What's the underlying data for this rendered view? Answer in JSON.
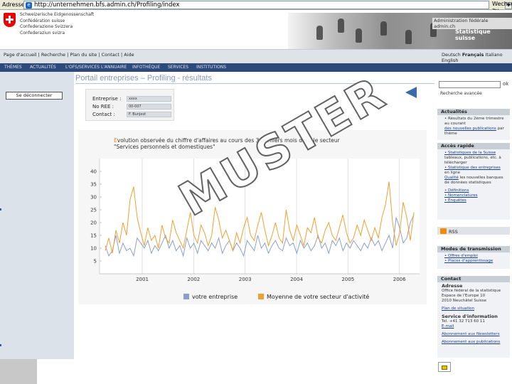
{
  "address_bar": {
    "label": "Adresse",
    "url": "http://unternehmen.bfs.admin.ch/Profiling/index",
    "go": "Wechseln zu"
  },
  "header": {
    "confederation": [
      "Schweizerische Eidgenossenschaft",
      "Confédération suisse",
      "Confederazione Svizzera",
      "Confederaziun svizra"
    ],
    "admin_link": "Administration fédérale admin.ch",
    "office": "Statistique suisse"
  },
  "utility": {
    "links": "Page d'accueil | Recherche | Plan du site | Contact | Aide",
    "lang_prefix": "Deutsch",
    "lang_current": "Français",
    "lang_it": "Italiano",
    "lang_en": "English"
  },
  "nav": [
    "THÈMES",
    "ACTUALITÉS",
    "L'OFS/SERVICES",
    "L'ANNUAIRE",
    "INFOTHÈQUE",
    "SERVICES",
    "INSTITUTIONS"
  ],
  "left": {
    "logout": "Se déconnecter"
  },
  "main": {
    "title": "Portail entreprises – Profiling - résultats",
    "labels": [
      "Entreprise :",
      "No REE :",
      "Contact :"
    ],
    "values": [
      "xxxx",
      "00-007",
      "F. Bunjest"
    ]
  },
  "chart_data": {
    "type": "line",
    "title_first": "E",
    "title_line1": "volution observée du chiffre d'affaires au cours des 3 derniers mois dans le secteur",
    "title_line2": "\"Services personnels et domestiques\"",
    "ylim": [
      0,
      45
    ],
    "yticks": [
      5,
      10,
      15,
      20,
      25,
      30,
      35,
      40
    ],
    "xticks": [
      "2001",
      "2002",
      "2003",
      "2004",
      "2005",
      "2006"
    ],
    "colors": {
      "company": "#8aa0c8",
      "sector": "#f0a030"
    },
    "series": [
      {
        "name": "votre entreprise",
        "values": [
          11,
          7,
          9,
          15,
          8,
          12,
          9,
          10,
          7,
          14,
          12,
          10,
          13,
          8,
          11,
          9,
          12,
          15,
          10,
          13,
          9,
          11,
          7,
          14,
          10,
          12,
          8,
          13,
          11,
          9,
          12,
          10,
          14,
          8,
          11,
          13,
          9,
          12,
          10,
          7,
          13,
          11,
          9,
          15,
          10,
          12,
          8,
          11,
          13,
          10,
          9,
          14,
          11,
          12,
          8,
          13,
          10,
          12,
          9,
          11,
          15,
          10,
          12,
          8,
          13,
          11,
          14,
          9,
          12,
          10,
          13,
          11,
          9,
          12,
          10,
          14,
          11,
          13,
          9,
          12,
          15,
          10,
          22,
          18,
          12,
          14,
          20,
          23
        ]
      },
      {
        "name": "Moyenne de votre secteur d'activité",
        "values": [
          9,
          14,
          8,
          17,
          12,
          20,
          15,
          29,
          34,
          22,
          16,
          11,
          18,
          13,
          15,
          10,
          19,
          14,
          12,
          21,
          16,
          13,
          10,
          17,
          24,
          15,
          12,
          19,
          16,
          11,
          15,
          26,
          21,
          14,
          17,
          13,
          9,
          16,
          12,
          18,
          22,
          15,
          13,
          19,
          24,
          17,
          11,
          15,
          20,
          14,
          12,
          25,
          17,
          13,
          19,
          15,
          11,
          18,
          16,
          22,
          14,
          12,
          17,
          20,
          15,
          13,
          18,
          23,
          16,
          12,
          14,
          19,
          15,
          21,
          17,
          13,
          18,
          14,
          22,
          27,
          36,
          20,
          11,
          16,
          28,
          22,
          13,
          24
        ]
      }
    ]
  },
  "right": {
    "search_go": "ok",
    "advanced": "Recherche avancée",
    "box1_head": "Actualités",
    "box1_lines": [
      "• Résultats du 2ème trimestre",
      "au courant"
    ],
    "box1_link": "des nouvelles publications",
    "box1_tail": "par thème",
    "box2_head": "Accès rapide",
    "box2_lines": [
      "• Statistiques de la Suisse",
      "tableaux, publications, etc. à télécharger",
      "• Statistique des entreprises",
      "en ligne"
    ],
    "box2_link": "Qualité",
    "box2_tail": "les nouvelles banques de données statistiques",
    "box2_more": [
      "• Définitions",
      "• Nomenclatures",
      "• Enquêtes"
    ],
    "rss": "RSS",
    "box3_head": "Modes de transmission",
    "box3_lines": [
      "• Offres d'emploi",
      "• Places d'apprentissage"
    ],
    "box4_head": "Contact",
    "box4_title": "Adresse",
    "box4_lines": [
      "Office fédéral de la statistique",
      "Espace de l'Europe 10",
      "2010 Neuchâtel Suisse"
    ],
    "box4_link1": "Plan de situation",
    "box4_title2": "Service d'information",
    "box4_lines2": [
      "Tel. +41 32 713 60 11",
      "E-mail"
    ],
    "box4_link2": "Abonnement aux Newsletters",
    "box4_link3": "Abonnement aux publications"
  }
}
